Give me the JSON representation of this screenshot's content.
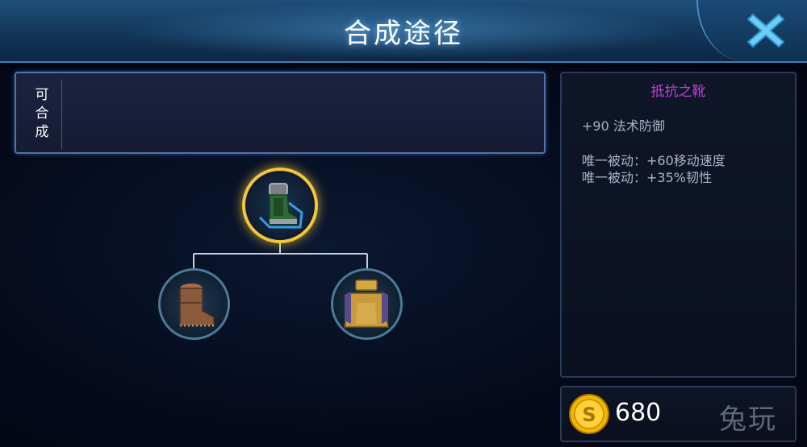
{
  "header": {
    "title": "合成途径",
    "close_icon": "close-icon"
  },
  "craft_panel": {
    "label": "可合成"
  },
  "tree": {
    "root": {
      "icon": "boots-of-resistance-icon"
    },
    "children": [
      {
        "icon": "leather-boots-icon"
      },
      {
        "icon": "golden-armor-icon"
      }
    ]
  },
  "item_detail": {
    "name": "抵抗之靴",
    "stats": [
      "+90 法术防御"
    ],
    "passives": [
      "唯一被动：+60移动速度",
      "唯一被动：+35%韧性"
    ]
  },
  "gold": {
    "icon": "gold-coin-icon",
    "amount": "680"
  },
  "watermark": "兔玩",
  "colors": {
    "item_name": "#c23fd9",
    "gold": "#f0b800",
    "accent": "#3f7fb3"
  }
}
